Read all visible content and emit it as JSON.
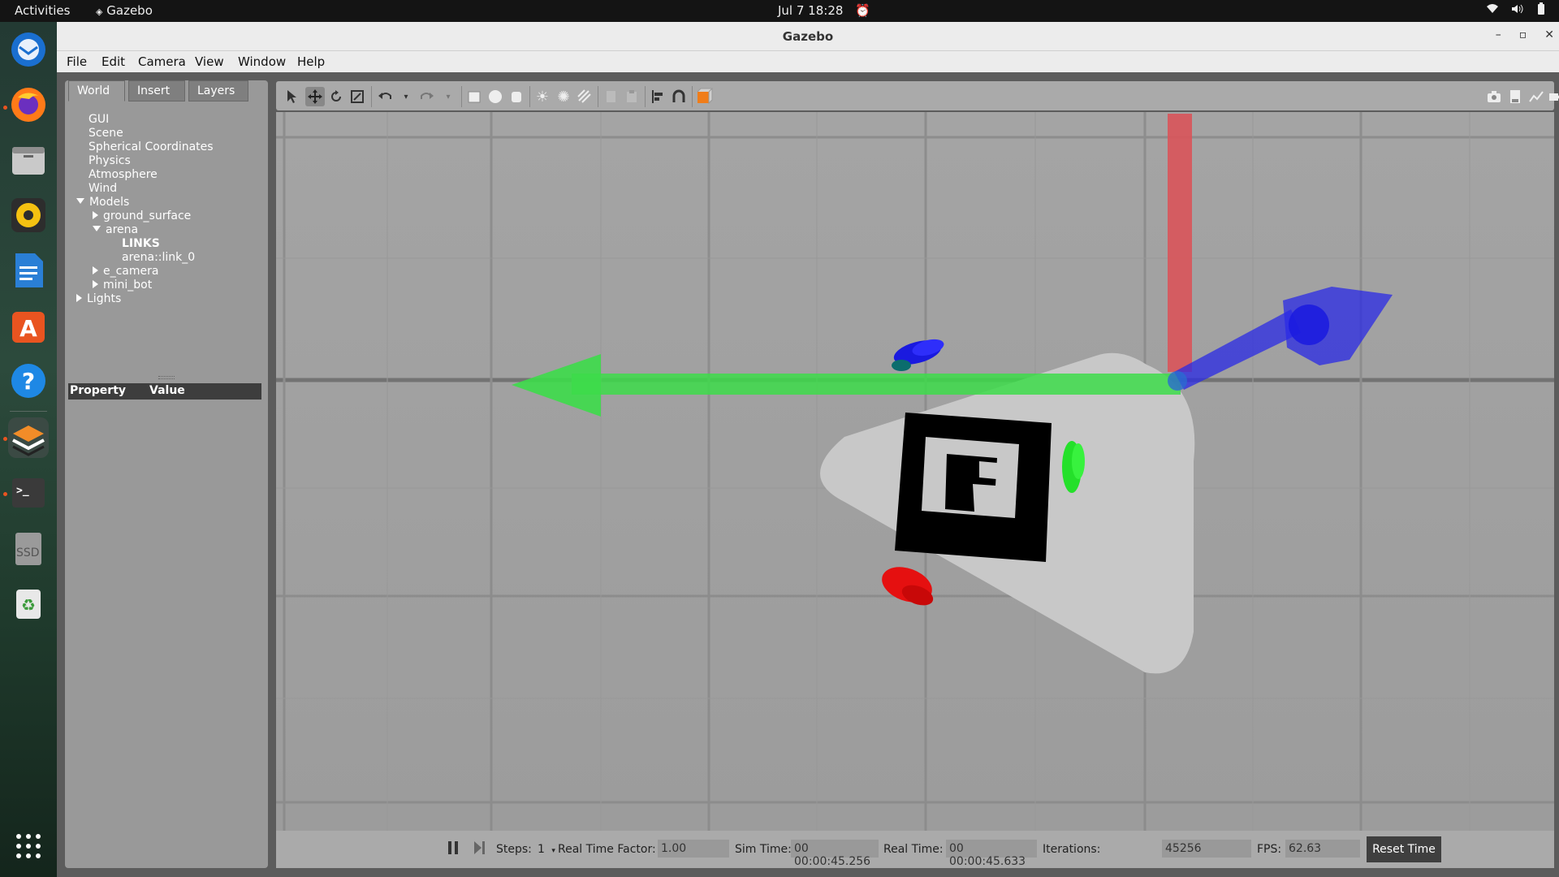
{
  "topbar": {
    "activities": "Activities",
    "app_name": "Gazebo",
    "clock": "Jul 7  18:28"
  },
  "dock": {
    "items": [
      {
        "name": "Thunderbird",
        "icon": "thunderbird-icon"
      },
      {
        "name": "Firefox",
        "icon": "firefox-icon"
      },
      {
        "name": "Files",
        "icon": "files-icon"
      },
      {
        "name": "Rhythmbox",
        "icon": "rhythmbox-icon"
      },
      {
        "name": "LibreOffice Writer",
        "icon": "writer-icon"
      },
      {
        "name": "Ubuntu Software",
        "icon": "software-icon"
      },
      {
        "name": "Help",
        "icon": "help-icon"
      },
      {
        "name": "Gazebo",
        "icon": "gazebo-icon"
      },
      {
        "name": "Terminal",
        "icon": "terminal-icon"
      },
      {
        "name": "SSD",
        "icon": "drive-icon"
      },
      {
        "name": "Trash",
        "icon": "trash-icon"
      },
      {
        "name": "Show Applications",
        "icon": "app-grid-icon"
      }
    ],
    "ssd_label": "SSD"
  },
  "window": {
    "title": "Gazebo"
  },
  "menubar": {
    "items": [
      "File",
      "Edit",
      "Camera",
      "View",
      "Window",
      "Help"
    ]
  },
  "leftpanel": {
    "tabs": [
      "World",
      "Insert",
      "Layers"
    ],
    "tree": {
      "gui": "GUI",
      "scene": "Scene",
      "spherical": "Spherical Coordinates",
      "physics": "Physics",
      "atmosphere": "Atmosphere",
      "wind": "Wind",
      "models": "Models",
      "ground_surface": "ground_surface",
      "arena": "arena",
      "links": "LINKS",
      "arena_link": "arena::link_0",
      "e_camera": "e_camera",
      "mini_bot": "mini_bot",
      "lights": "Lights"
    },
    "property_header": {
      "property": "Property",
      "value": "Value"
    }
  },
  "bottombar": {
    "steps_label": "Steps:",
    "steps_value": "1",
    "rtf_label": "Real Time Factor:",
    "rtf_value": "1.00",
    "sim_time_label": "Sim Time:",
    "sim_time_value": "00 00:00:45.256",
    "real_time_label": "Real Time:",
    "real_time_value": "00 00:00:45.633",
    "iterations_label": "Iterations:",
    "iterations_value": "45256",
    "fps_label": "FPS:",
    "fps_value": "62.63",
    "reset_label": "Reset Time"
  },
  "colors": {
    "x_axis": "#d9545a",
    "y_axis": "#3ddc4a",
    "z_axis": "#2a2ae6",
    "viewport_bg": "#a0a0a0",
    "accent_orange": "#e95420"
  }
}
